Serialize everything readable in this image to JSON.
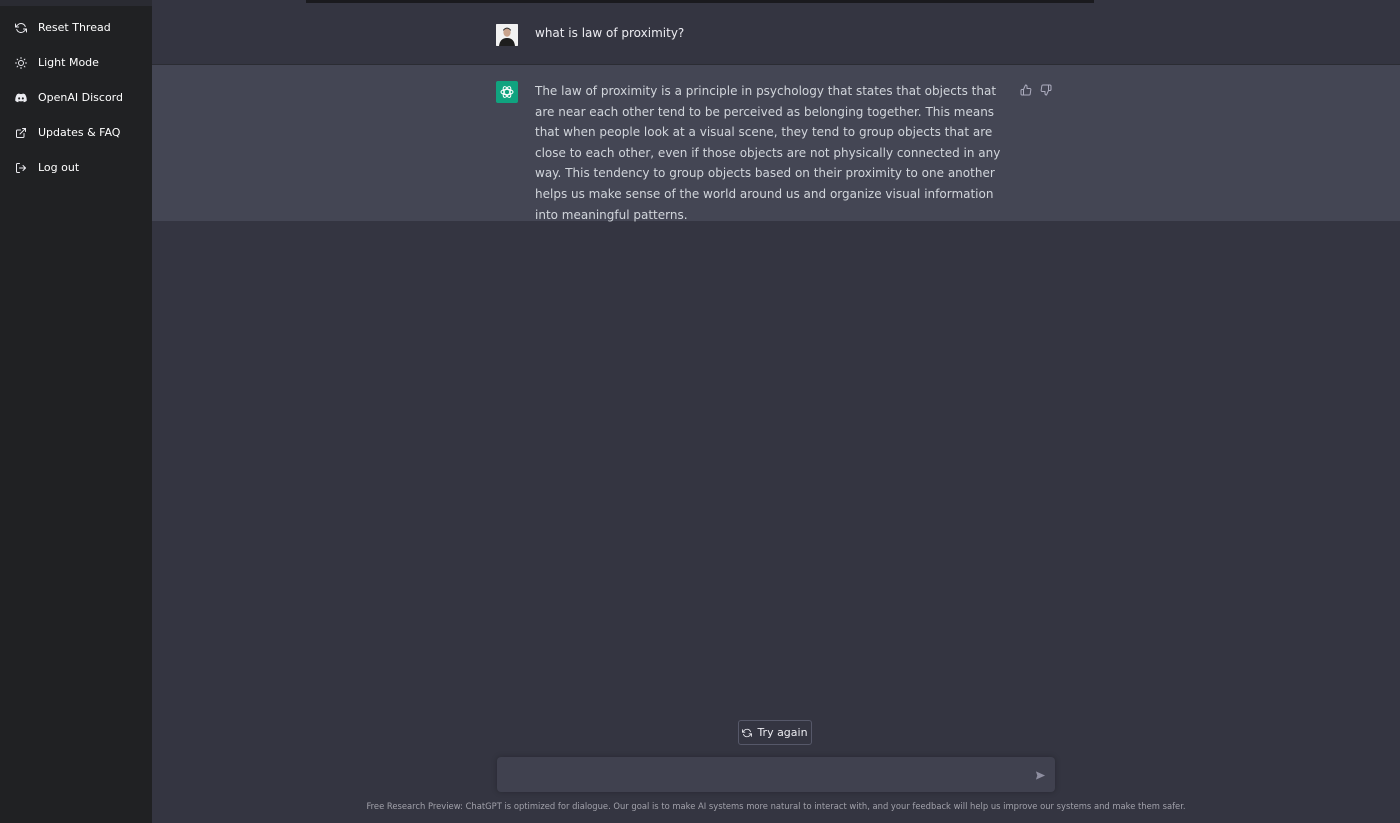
{
  "sidebar": {
    "items": [
      {
        "label": "Reset Thread",
        "icon": "refresh-icon"
      },
      {
        "label": "Light Mode",
        "icon": "sun-icon"
      },
      {
        "label": "OpenAI Discord",
        "icon": "discord-icon"
      },
      {
        "label": "Updates & FAQ",
        "icon": "external-link-icon"
      },
      {
        "label": "Log out",
        "icon": "logout-icon"
      }
    ]
  },
  "conversation": {
    "user_message": "what is law of proximity?",
    "assistant_message": "The law of proximity is a principle in psychology that states that objects that are near each other tend to be perceived as belonging together. This means that when people look at a visual scene, they tend to group objects that are close to each other, even if those objects are not physically connected in any way. This tendency to group objects based on their proximity to one another helps us make sense of the world around us and organize visual information into meaningful patterns."
  },
  "actions": {
    "try_again_label": "Try again"
  },
  "composer": {
    "value": "",
    "placeholder": ""
  },
  "footer": {
    "note": "Free Research Preview: ChatGPT is optimized for dialogue. Our goal is to make AI systems more natural to interact with, and your feedback will help us improve our systems and make them safer."
  },
  "colors": {
    "sidebar_bg": "#202123",
    "main_bg": "#343541",
    "assistant_bg": "#444654",
    "brand": "#10a37f"
  }
}
